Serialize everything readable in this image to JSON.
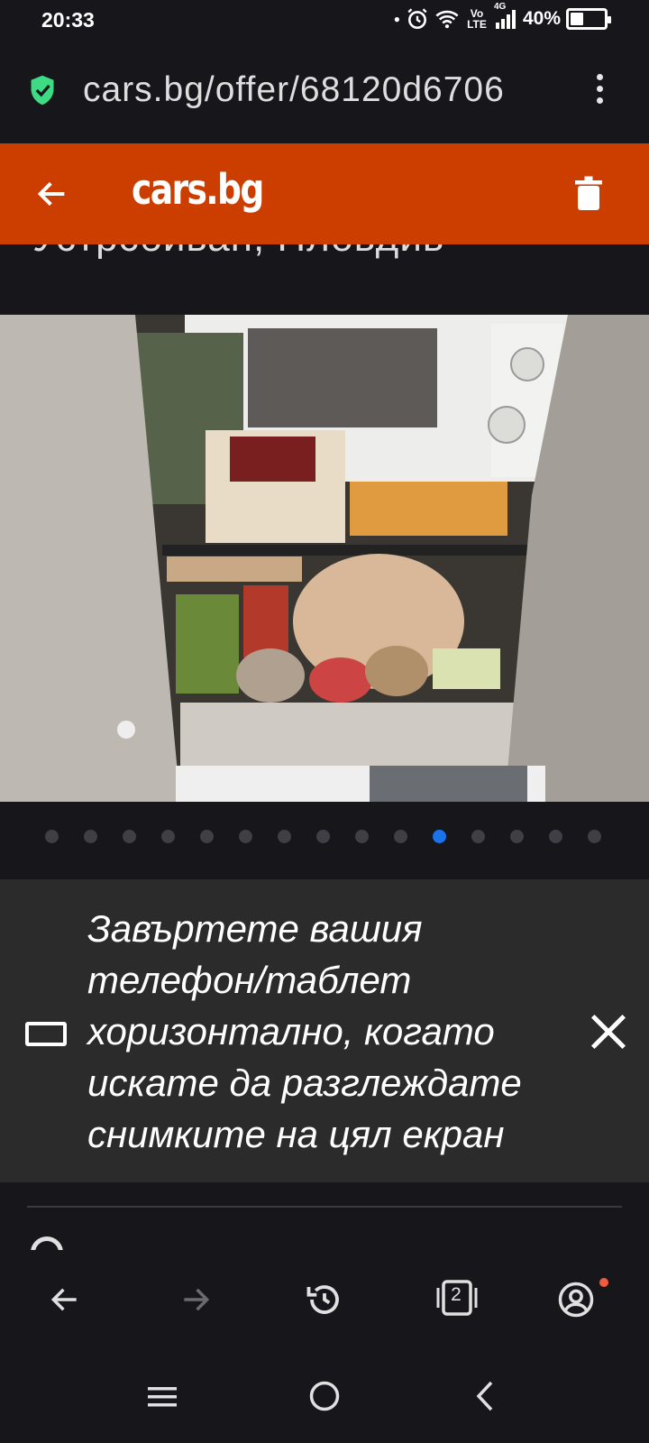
{
  "status_bar": {
    "time": "20:33",
    "network_label": "Vo LTE",
    "network_gen": "4G",
    "battery_percent": "40%",
    "battery_level": 0.4
  },
  "url_bar": {
    "url": "cars.bg/offer/68120d6706",
    "secure_icon": "shield-check-icon"
  },
  "site_header": {
    "logo_text": "cars.bg",
    "color": "#cc3d00"
  },
  "listing": {
    "partial_location_text": "Устрсбиван, Пловдив"
  },
  "gallery": {
    "total_photos": 15,
    "current_index": 10,
    "active_color": "#1a73e8"
  },
  "rotate_banner": {
    "message": "Завъртете вашия телефон/таблет хоризонтално, когато искате да разглеждате снимките на цял екран"
  },
  "browser_toolbar": {
    "tab_count": "2"
  }
}
